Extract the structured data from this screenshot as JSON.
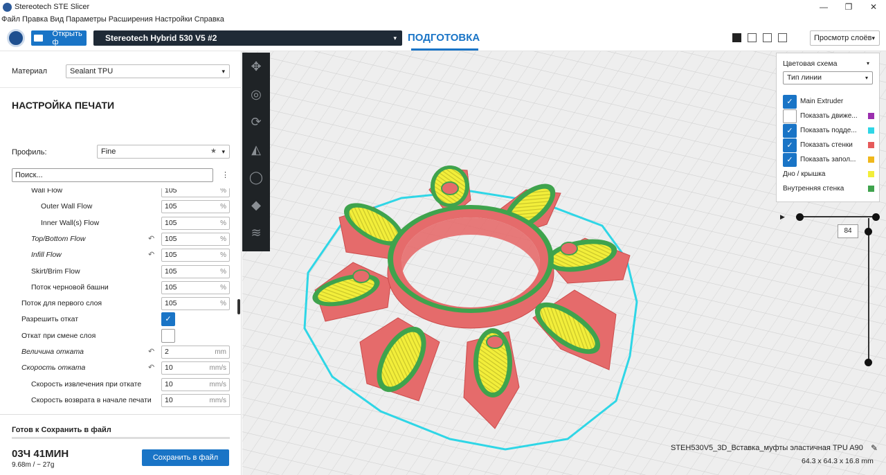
{
  "window": {
    "title": "Stereotech STE Slicer",
    "controls": [
      "—",
      "❐",
      "✕"
    ]
  },
  "menu": [
    "Файл",
    "Правка",
    "Вид",
    "Параметры",
    "Расширения",
    "Настройки",
    "Справка"
  ],
  "toolbar": {
    "open_label": "Открыть ф",
    "printer": "Stereotech Hybrid 530 V5 #2",
    "stage": "ПОДГОТОВКА",
    "view_mode": "Просмотр слоёв"
  },
  "panel": {
    "material_label": "Материал",
    "material_value": "Sealant TPU",
    "section_title": "НАСТРОЙКА ПЕЧАТИ",
    "profile_label": "Профиль:",
    "profile_value": "Fine",
    "search_placeholder": "Поиск...",
    "settings": [
      {
        "name": "Wall Flow",
        "value": "105",
        "unit": "%",
        "italic": false,
        "indent": 2,
        "reset": false
      },
      {
        "name": "Outer Wall Flow",
        "value": "105",
        "unit": "%",
        "italic": false,
        "indent": 3,
        "reset": false
      },
      {
        "name": "Inner Wall(s) Flow",
        "value": "105",
        "unit": "%",
        "italic": false,
        "indent": 3,
        "reset": false
      },
      {
        "name": "Top/Bottom Flow",
        "value": "105",
        "unit": "%",
        "italic": true,
        "indent": 2,
        "reset": true
      },
      {
        "name": "Infill Flow",
        "value": "105",
        "unit": "%",
        "italic": true,
        "indent": 2,
        "reset": true
      },
      {
        "name": "Skirt/Brim Flow",
        "value": "105",
        "unit": "%",
        "italic": false,
        "indent": 2,
        "reset": false
      },
      {
        "name": "Поток черновой башни",
        "value": "105",
        "unit": "%",
        "italic": false,
        "indent": 2,
        "reset": false
      },
      {
        "name": "Поток для первого слоя",
        "value": "105",
        "unit": "%",
        "italic": false,
        "indent": 1,
        "reset": false
      },
      {
        "name": "Разрешить откат",
        "checkbox": true,
        "checked": true,
        "italic": false,
        "indent": 1,
        "reset": false
      },
      {
        "name": "Откат при смене слоя",
        "checkbox": true,
        "checked": false,
        "italic": false,
        "indent": 1,
        "reset": false
      },
      {
        "name": "Величина отката",
        "value": "2",
        "unit": "mm",
        "italic": true,
        "indent": 1,
        "reset": true
      },
      {
        "name": "Скорость отката",
        "value": "10",
        "unit": "mm/s",
        "italic": true,
        "indent": 1,
        "reset": true
      },
      {
        "name": "Скорость извлечения при откате",
        "value": "10",
        "unit": "mm/s",
        "italic": false,
        "indent": 2,
        "reset": false
      },
      {
        "name": "Скорость возврата в начале печати",
        "value": "10",
        "unit": "mm/s",
        "italic": false,
        "indent": 2,
        "reset": false
      }
    ],
    "ready_label": "Готов к Сохранить в файл",
    "print_time": "03Ч 41МИН",
    "print_stats": "9.68m / ~ 27g",
    "save_label": "Сохранить в файл"
  },
  "legend": {
    "header": "Цветовая схема",
    "scheme": "Тип линии",
    "items": [
      {
        "label": "Main Extruder",
        "checkbox": true,
        "checked": true,
        "color": ""
      },
      {
        "label": "Показать движе...",
        "checkbox": true,
        "checked": false,
        "color": "#9b2fae"
      },
      {
        "label": "Показать подде...",
        "checkbox": true,
        "checked": true,
        "color": "#2fd6e6"
      },
      {
        "label": "Показать стенки",
        "checkbox": true,
        "checked": true,
        "color": "#e65a5a"
      },
      {
        "label": "Показать запол...",
        "checkbox": true,
        "checked": true,
        "color": "#f0b81c"
      },
      {
        "label": "Дно / крышка",
        "checkbox": false,
        "checked": false,
        "color": "#f2ee3a"
      },
      {
        "label": "Внутренняя стенка",
        "checkbox": false,
        "checked": false,
        "color": "#3fa34d"
      }
    ]
  },
  "layer": {
    "current": "84"
  },
  "model": {
    "name": "STEH530V5_3D_Вставка_муфты эластичная TPU A90",
    "dimensions": "64.3 x 64.3 x 16.8 mm"
  }
}
